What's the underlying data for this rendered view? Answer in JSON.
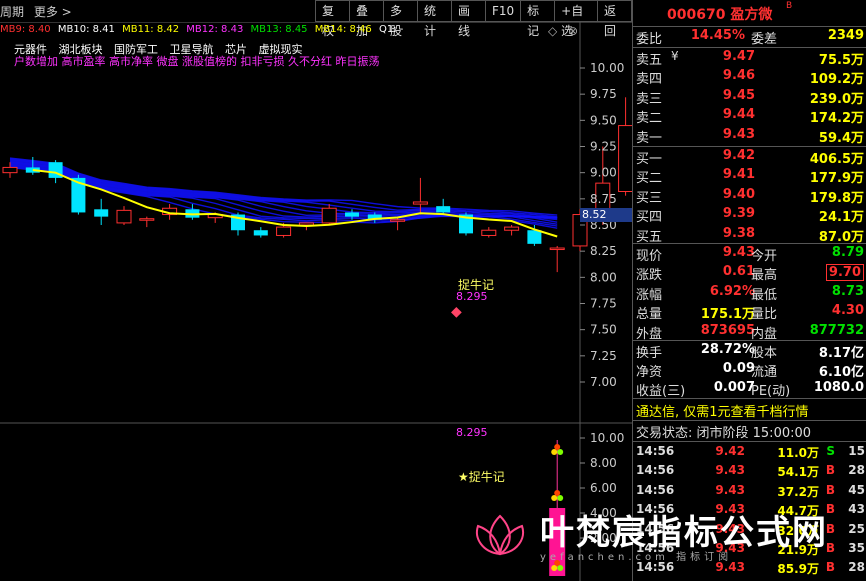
{
  "toolbar": {
    "left_items": [
      "周期",
      "更多 >"
    ],
    "buttons": [
      "复权",
      "叠加",
      "多股",
      "统计",
      "画线",
      "F10",
      "标记",
      "+自选",
      "返回"
    ]
  },
  "mb_line": [
    {
      "text": "MB9: 8.40",
      "color": "#ff3030"
    },
    {
      "text": "MB10: 8.41",
      "color": "#ffffff"
    },
    {
      "text": "MB11: 8.42",
      "color": "#ffff00"
    },
    {
      "text": "MB12: 8.43",
      "color": "#ff33ff"
    },
    {
      "text": "MB13: 8.45",
      "color": "#00e000"
    },
    {
      "text": "MB14: 8.46",
      "color": "#ffff00"
    },
    {
      "text": "Q1: -",
      "color": "#ffffff"
    }
  ],
  "sectors": [
    "元器件",
    "湖北板块",
    "国防军工",
    "卫星导航",
    "芯片",
    "虚拟现实"
  ],
  "tags": "户数增加 高市盈率 高市净率 微盘 涨股值榜的 扣非亏损 久不分红 昨日振荡",
  "price_axis": [
    "10.00",
    "9.75",
    "9.50",
    "9.25",
    "9.00",
    "8.75",
    "8.50",
    "8.25",
    "8.00",
    "7.75",
    "7.50",
    "7.25",
    "7.00"
  ],
  "current_price_tag": "8.52",
  "annotation_label": "捉牛记",
  "annotation_value": "8.295",
  "lower_axis": [
    "10.00",
    "8.00",
    "6.00",
    "4.00",
    "2.00"
  ],
  "lower_value": "8.295",
  "lower_label": "★捉牛记",
  "chart_data": {
    "type": "candlestick",
    "candles": [
      {
        "o": 9.0,
        "h": 9.1,
        "l": 8.95,
        "c": 9.05
      },
      {
        "o": 9.05,
        "h": 9.15,
        "l": 8.98,
        "c": 9.0
      },
      {
        "o": 9.1,
        "h": 9.12,
        "l": 8.9,
        "c": 8.95
      },
      {
        "o": 8.95,
        "h": 8.98,
        "l": 8.6,
        "c": 8.62
      },
      {
        "o": 8.65,
        "h": 8.75,
        "l": 8.5,
        "c": 8.58
      },
      {
        "o": 8.52,
        "h": 8.68,
        "l": 8.5,
        "c": 8.64
      },
      {
        "o": 8.56,
        "h": 8.58,
        "l": 8.48,
        "c": 8.56
      },
      {
        "o": 8.6,
        "h": 8.7,
        "l": 8.55,
        "c": 8.66
      },
      {
        "o": 8.65,
        "h": 8.7,
        "l": 8.55,
        "c": 8.57
      },
      {
        "o": 8.57,
        "h": 8.62,
        "l": 8.52,
        "c": 8.6
      },
      {
        "o": 8.6,
        "h": 8.62,
        "l": 8.4,
        "c": 8.45
      },
      {
        "o": 8.45,
        "h": 8.48,
        "l": 8.38,
        "c": 8.4
      },
      {
        "o": 8.4,
        "h": 8.52,
        "l": 8.38,
        "c": 8.48
      },
      {
        "o": 8.5,
        "h": 8.52,
        "l": 8.45,
        "c": 8.52
      },
      {
        "o": 8.52,
        "h": 8.7,
        "l": 8.5,
        "c": 8.66
      },
      {
        "o": 8.62,
        "h": 8.65,
        "l": 8.55,
        "c": 8.58
      },
      {
        "o": 8.6,
        "h": 8.62,
        "l": 8.52,
        "c": 8.55
      },
      {
        "o": 8.55,
        "h": 8.58,
        "l": 8.45,
        "c": 8.55
      },
      {
        "o": 8.7,
        "h": 8.95,
        "l": 8.6,
        "c": 8.72
      },
      {
        "o": 8.68,
        "h": 8.75,
        "l": 8.6,
        "c": 8.62
      },
      {
        "o": 8.6,
        "h": 8.62,
        "l": 8.4,
        "c": 8.42
      },
      {
        "o": 8.4,
        "h": 8.48,
        "l": 8.38,
        "c": 8.45
      },
      {
        "o": 8.45,
        "h": 8.5,
        "l": 8.4,
        "c": 8.48
      },
      {
        "o": 8.45,
        "h": 8.5,
        "l": 8.3,
        "c": 8.32
      },
      {
        "o": 8.28,
        "h": 8.3,
        "l": 8.05,
        "c": 8.28
      },
      {
        "o": 8.3,
        "h": 8.65,
        "l": 8.25,
        "c": 8.6
      },
      {
        "o": 8.58,
        "h": 9.25,
        "l": 8.5,
        "c": 8.9
      },
      {
        "o": 8.82,
        "h": 9.72,
        "l": 8.78,
        "c": 9.45
      }
    ]
  },
  "quote": {
    "code_name": "000670 盈方微",
    "superscript": "B",
    "weibi_label": "委比",
    "weibi_value": "14.45%",
    "weicha_label": "委差",
    "weicha_value": "2349",
    "asks": [
      {
        "label": "卖五",
        "flag": "¥",
        "price": "9.47",
        "vol": "75.5万"
      },
      {
        "label": "卖四",
        "flag": "",
        "price": "9.46",
        "vol": "109.2万"
      },
      {
        "label": "卖三",
        "flag": "",
        "price": "9.45",
        "vol": "239.0万"
      },
      {
        "label": "卖二",
        "flag": "",
        "price": "9.44",
        "vol": "174.2万"
      },
      {
        "label": "卖一",
        "flag": "",
        "price": "9.43",
        "vol": "59.4万"
      }
    ],
    "bids": [
      {
        "label": "买一",
        "price": "9.42",
        "vol": "406.5万"
      },
      {
        "label": "买二",
        "price": "9.41",
        "vol": "177.9万"
      },
      {
        "label": "买三",
        "price": "9.40",
        "vol": "179.8万"
      },
      {
        "label": "买四",
        "price": "9.39",
        "vol": "24.1万"
      },
      {
        "label": "买五",
        "price": "9.38",
        "vol": "87.0万"
      }
    ],
    "stats": [
      {
        "l1": "现价",
        "v1": "9.43",
        "c1": "#ff3030",
        "l2": "今开",
        "v2": "8.79",
        "c2": "#00e000"
      },
      {
        "l1": "涨跌",
        "v1": "0.61",
        "c1": "#ff3030",
        "l2": "最高",
        "v2": "9.70",
        "c2": "#ff3030"
      },
      {
        "l1": "涨幅",
        "v1": "6.92%",
        "c1": "#ff3030",
        "l2": "最低",
        "v2": "8.73",
        "c2": "#00e000"
      },
      {
        "l1": "总量",
        "v1": "175.1万",
        "c1": "#ffff00",
        "l2": "量比",
        "v2": "4.30",
        "c2": "#ff3030"
      },
      {
        "l1": "外盘",
        "v1": "873695",
        "c1": "#ff3030",
        "l2": "内盘",
        "v2": "877732",
        "c2": "#00e000"
      }
    ],
    "fund": [
      {
        "l1": "换手",
        "v1": "28.72%",
        "l2": "股本",
        "v2": "8.17亿"
      },
      {
        "l1": "净资",
        "v1": "0.09",
        "l2": "流通",
        "v2": "6.10亿"
      },
      {
        "l1": "收益(三)",
        "v1": "0.007",
        "l2": "PE(动)",
        "v2": "1080.0"
      }
    ],
    "notice": "通达信, 仅需1元查看千档行情",
    "trade_status": "交易状态: 闭市阶段 15:00:00",
    "ticks": [
      {
        "t": "14:56",
        "p": "9.42",
        "v": "11.0万",
        "s": "S",
        "n": "15"
      },
      {
        "t": "14:56",
        "p": "9.43",
        "v": "54.1万",
        "s": "B",
        "n": "28"
      },
      {
        "t": "14:56",
        "p": "9.43",
        "v": "37.2万",
        "s": "B",
        "n": "45"
      },
      {
        "t": "14:56",
        "p": "9.43",
        "v": "44.7万",
        "s": "B",
        "n": "43"
      },
      {
        "t": "14:56",
        "p": "9.43",
        "v": "32.0万",
        "s": "B",
        "n": "25"
      },
      {
        "t": "14:56",
        "p": "9.43",
        "v": "21.9万",
        "s": "B",
        "n": "35"
      },
      {
        "t": "14:56",
        "p": "9.43",
        "v": "85.9万",
        "s": "B",
        "n": "28"
      }
    ]
  },
  "watermark": {
    "title": "叶梵宸指标公式网",
    "sub": "yefanchen.com 指标订阅"
  },
  "colors": {
    "up": "#ff3030",
    "down": "#00e5ff",
    "ma": "#ffff00",
    "band": "#1010ff"
  }
}
